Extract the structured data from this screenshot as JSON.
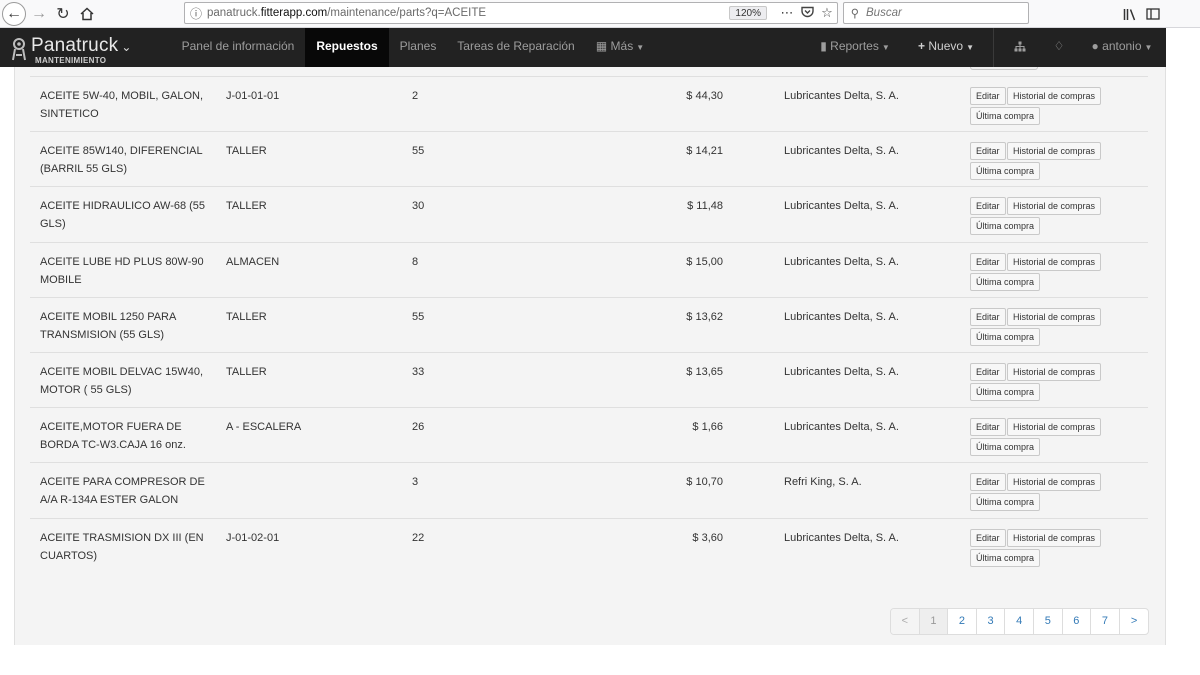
{
  "browser": {
    "url_host": "panatruck.fitterapp.com",
    "url_path": "/maintenance/parts?q=ACEITE",
    "url_prefix": "panatruck.",
    "url_domain": "fitterapp.com",
    "zoom": "120%",
    "search_placeholder": "Buscar"
  },
  "navbar": {
    "brand": "Panatruck",
    "brand_sub": "MANTENIMIENTO",
    "items": {
      "panel": "Panel de información",
      "repuestos": "Repuestos",
      "planes": "Planes",
      "tareas": "Tareas de Reparación",
      "mas": "Más",
      "reportes": "Reportes",
      "nuevo": "Nuevo",
      "user": "antonio"
    }
  },
  "buttons": {
    "edit": "Editar",
    "history": "Historial de compras",
    "last": "Última compra"
  },
  "parts": [
    {
      "name": "ACEITE 5W-40, MOBIL, GALON, SINTETICO",
      "location": "J-01-01-01",
      "qty": "2",
      "price": "$ 44,30",
      "supplier": "Lubricantes Delta, S. A."
    },
    {
      "name": "ACEITE 85W140, DIFERENCIAL (BARRIL 55 GLS)",
      "location": "TALLER",
      "qty": "55",
      "price": "$ 14,21",
      "supplier": "Lubricantes Delta, S. A."
    },
    {
      "name": "ACEITE HIDRAULICO AW-68 (55 GLS)",
      "location": "TALLER",
      "qty": "30",
      "price": "$ 11,48",
      "supplier": "Lubricantes Delta, S. A."
    },
    {
      "name": "ACEITE LUBE HD PLUS 80W-90 MOBILE",
      "location": "ALMACEN",
      "qty": "8",
      "price": "$ 15,00",
      "supplier": "Lubricantes Delta, S. A."
    },
    {
      "name": "ACEITE MOBIL 1250 PARA TRANSMISION (55 GLS)",
      "location": "TALLER",
      "qty": "55",
      "price": "$ 13,62",
      "supplier": "Lubricantes Delta, S. A."
    },
    {
      "name": "ACEITE MOBIL DELVAC 15W40, MOTOR ( 55 GLS)",
      "location": "TALLER",
      "qty": "33",
      "price": "$ 13,65",
      "supplier": "Lubricantes Delta, S. A."
    },
    {
      "name": "ACEITE,MOTOR FUERA DE BORDA TC-W3.CAJA 16 onz.",
      "location": "A - ESCALERA",
      "qty": "26",
      "price": "$ 1,66",
      "supplier": "Lubricantes Delta, S. A."
    },
    {
      "name": "ACEITE PARA COMPRESOR DE A/A R-134A ESTER GALON",
      "location": "",
      "qty": "3",
      "price": "$ 10,70",
      "supplier": "Refri King, S. A."
    },
    {
      "name": "ACEITE TRASMISION DX III (EN CUARTOS)",
      "location": "J-01-02-01",
      "qty": "22",
      "price": "$ 3,60",
      "supplier": "Lubricantes Delta, S. A."
    }
  ],
  "pagination": {
    "prev": "<",
    "next": ">",
    "pages": [
      "1",
      "2",
      "3",
      "4",
      "5",
      "6",
      "7"
    ],
    "current": "1"
  }
}
